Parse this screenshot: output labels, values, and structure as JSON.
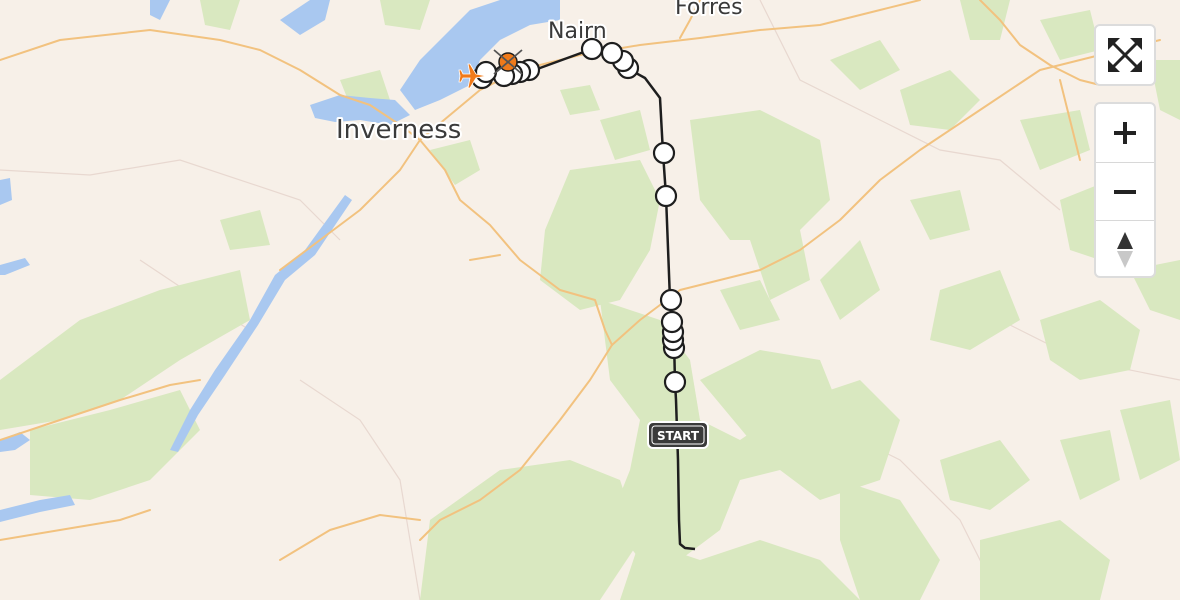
{
  "map": {
    "places": [
      {
        "name": "Nairn"
      },
      {
        "name": "Forres"
      },
      {
        "name": "Inverness"
      }
    ],
    "start_label": "START",
    "colors": {
      "land": "#f7f0e8",
      "forest": "#d9e8c0",
      "water": "#a9c8f0",
      "road": "#f2c27f",
      "route": "#1e1e1e",
      "waypoint": "#ffffff",
      "marker_orange": "#f07a1a"
    }
  },
  "controls": {
    "fullscreen_icon": "fullscreen-icon",
    "zoom_in_icon": "plus-icon",
    "zoom_out_icon": "minus-icon",
    "compass_icon": "compass-icon"
  }
}
